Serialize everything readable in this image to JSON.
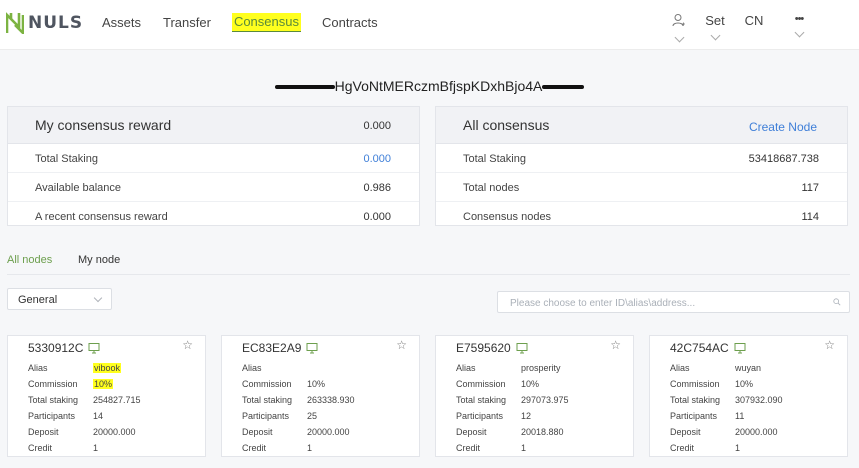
{
  "brand": {
    "name": "NULS"
  },
  "nav": {
    "items": [
      {
        "label": "Assets",
        "active": false
      },
      {
        "label": "Transfer",
        "active": false
      },
      {
        "label": "Consensus",
        "active": true
      },
      {
        "label": "Contracts",
        "active": false
      }
    ],
    "set_label": "Set",
    "lang_label": "CN",
    "more_label": "•••"
  },
  "address": {
    "visible_text": "HgVoNtMERczmBfjspKDxhBjo4A"
  },
  "my_reward": {
    "title": "My consensus reward",
    "value": "0.000",
    "rows": [
      {
        "label": "Total Staking",
        "value": "0.000",
        "link": true
      },
      {
        "label": "Available balance",
        "value": "0.986",
        "link": false
      },
      {
        "label": "A recent consensus reward",
        "value": "0.000",
        "link": false
      }
    ]
  },
  "all_consensus": {
    "title": "All consensus",
    "action_label": "Create Node",
    "rows": [
      {
        "label": "Total Staking",
        "value": "53418687.738"
      },
      {
        "label": "Total nodes",
        "value": "117"
      },
      {
        "label": "Consensus nodes",
        "value": "114"
      }
    ]
  },
  "tabs": [
    {
      "label": "All nodes",
      "active": true
    },
    {
      "label": "My node",
      "active": false
    }
  ],
  "filter": {
    "selected": "General",
    "search_placeholder": "Please choose to enter ID\\alias\\address..."
  },
  "field_labels": {
    "alias": "Alias",
    "commission": "Commission",
    "total_staking": "Total staking",
    "participants": "Participants",
    "deposit": "Deposit",
    "credit": "Credit"
  },
  "nodes": [
    {
      "id": "5330912C",
      "alias": "vibook",
      "commission": "10%",
      "total_staking": "254827.715",
      "participants": "14",
      "deposit": "20000.000",
      "credit": "1"
    },
    {
      "id": "EC83E2A9",
      "alias": "",
      "commission": "10%",
      "total_staking": "263338.930",
      "participants": "25",
      "deposit": "20000.000",
      "credit": "1"
    },
    {
      "id": "E7595620",
      "alias": "prosperity",
      "commission": "10%",
      "total_staking": "297073.975",
      "participants": "12",
      "deposit": "20018.880",
      "credit": "1"
    },
    {
      "id": "42C754AC",
      "alias": "wuyan",
      "commission": "10%",
      "total_staking": "307932.090",
      "participants": "11",
      "deposit": "20000.000",
      "credit": "1"
    }
  ],
  "colors": {
    "accent_green": "#6d9f4e",
    "link_blue": "#3f7fd8",
    "highlight_yellow": "#ffff1e",
    "page_bg": "#f6f7f9"
  },
  "icons": {
    "logo": "nuls-logo-icon",
    "user": "user-icon",
    "monitor": "monitor-icon",
    "star": "star-icon",
    "search": "search-icon",
    "chevron": "chevron-down-icon"
  }
}
